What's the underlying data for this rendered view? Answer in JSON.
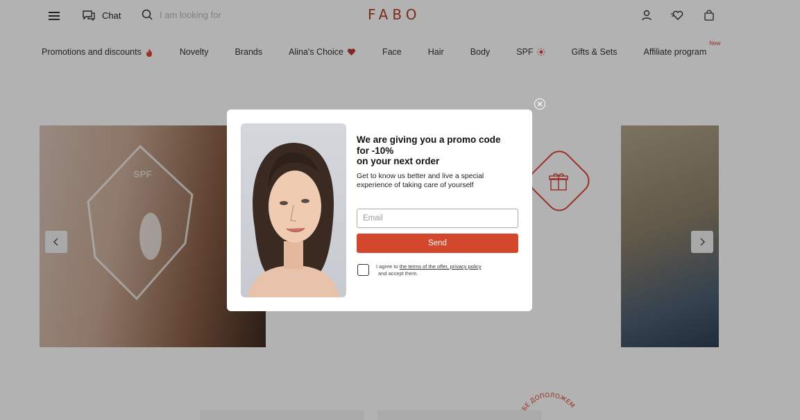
{
  "header": {
    "logo": "FABO",
    "chat_label": "Chat",
    "search_placeholder": "I am looking for"
  },
  "nav": {
    "items": [
      {
        "label": "Promotions and discounts"
      },
      {
        "label": "Novelty"
      },
      {
        "label": "Brands"
      },
      {
        "label": "Alina's Choice"
      },
      {
        "label": "Face"
      },
      {
        "label": "Hair"
      },
      {
        "label": "Body"
      },
      {
        "label": "SPF"
      },
      {
        "label": "Gifts & Sets"
      },
      {
        "label": "Affiliate program",
        "badge": "New"
      }
    ]
  },
  "banner": {
    "left_text": "SPF",
    "circle_text": "Я ТЕБЕ ДОПОЛОЖЕМ"
  },
  "modal": {
    "title_line1": "We are giving you a promo code",
    "title_line2": "for -10%",
    "title_line3": "on your next order",
    "subtitle": "Get to know us better and live a special experience of taking care of yourself",
    "email_placeholder": "Email",
    "send_label": "Send",
    "agree_prefix": "I agree to",
    "agree_link": "the terms of the offer, privacy policy",
    "agree_suffix": "and accept them."
  },
  "colors": {
    "brand": "#b33b2a",
    "accent_button": "#d3472c"
  }
}
